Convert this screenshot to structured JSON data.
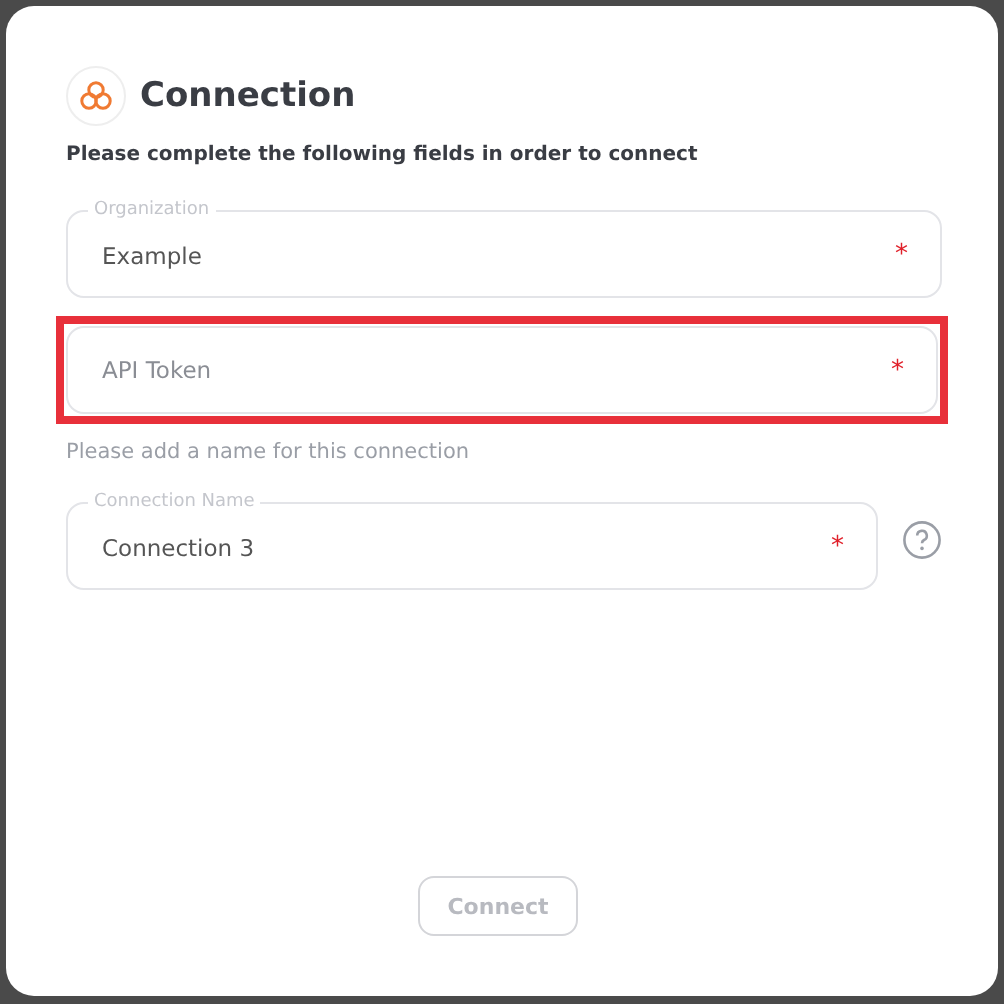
{
  "dialog": {
    "title": "Connection",
    "subtitle": "Please complete the following fields in order to connect",
    "fields": [
      {
        "label": "Organization",
        "value": "Example",
        "required_mark": "*",
        "highlighted": false
      },
      {
        "placeholder": "API Token",
        "required_mark": "*",
        "highlighted": true
      }
    ],
    "name_prompt": "Please add a name for this connection",
    "name_fields": [
      {
        "label": "Connection Name",
        "value": "Connection 3",
        "required_mark": "*",
        "highlighted": false,
        "help": true
      }
    ],
    "button": {
      "label": "Connect",
      "disabled": true
    }
  }
}
